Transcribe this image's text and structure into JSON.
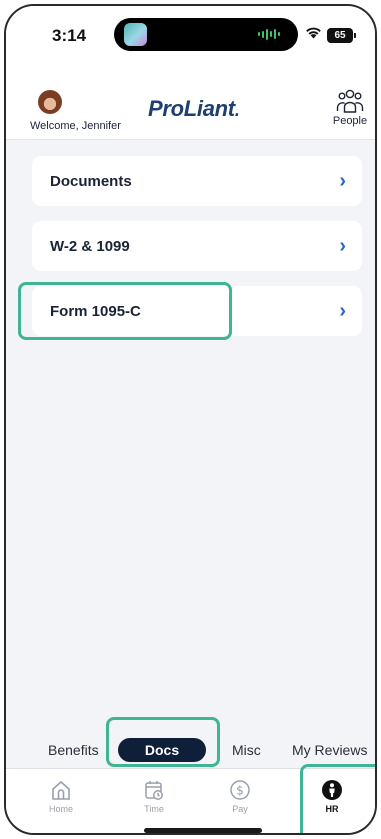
{
  "status_bar": {
    "time": "3:14",
    "battery": "65",
    "icons": [
      "dynamic-island-media-thumbnail",
      "audio-waveform-icon",
      "wifi-icon",
      "battery-icon"
    ]
  },
  "header": {
    "welcome": "Welcome, Jennifer",
    "logo_text": "ProLiant",
    "logo_dot": ".",
    "people_label": "People",
    "icons": [
      "avatar",
      "people-icon"
    ]
  },
  "docs_list": [
    {
      "label": "Documents"
    },
    {
      "label": "W-2 & 1099"
    },
    {
      "label": "Form 1095-C"
    }
  ],
  "chevron": "›",
  "segment_tabs": {
    "items": [
      "Benefits",
      "Docs",
      "Misc",
      "My Reviews"
    ],
    "selected": "Docs"
  },
  "bottom_nav": {
    "items": [
      {
        "label": "Home",
        "icon": "home-icon"
      },
      {
        "label": "Time",
        "icon": "calendar-clock-icon"
      },
      {
        "label": "Pay",
        "icon": "dollar-coin-icon"
      },
      {
        "label": "HR",
        "icon": "person-icon"
      }
    ],
    "selected": "HR"
  },
  "colors": {
    "brand": "#1e3f6f",
    "chevron": "#2a66c8",
    "active_tab": "#0f1f3a",
    "highlight": "#3fb595",
    "background": "#f3f4f7"
  }
}
